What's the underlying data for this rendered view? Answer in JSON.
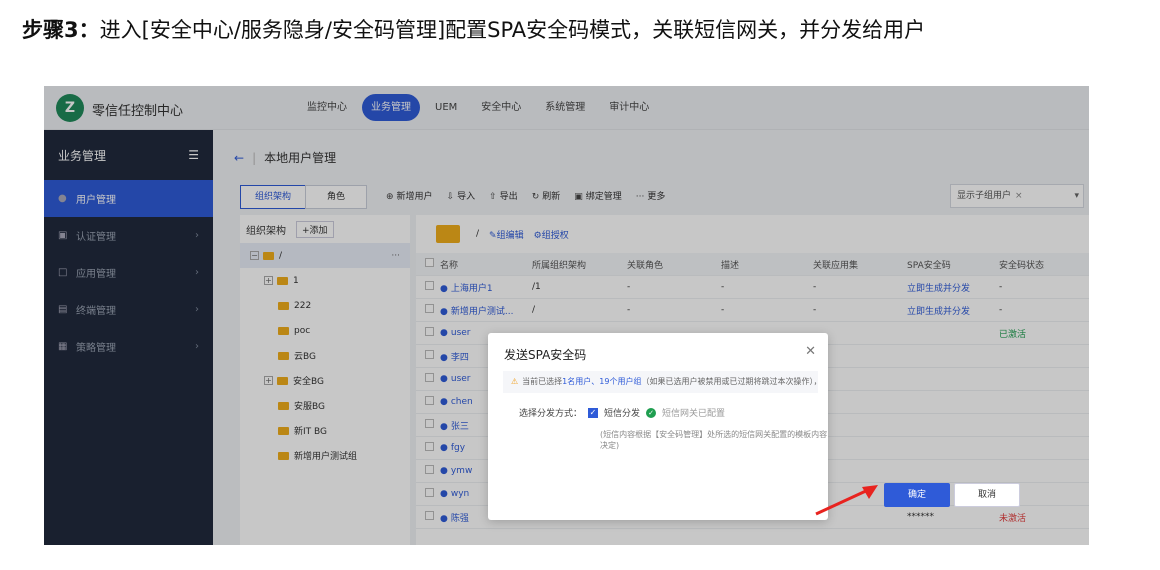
{
  "step": {
    "prefix": "步骤3：",
    "text": "进入[安全中心/服务隐身/安全码管理]配置SPA安全码模式，关联短信网关，并分发给用户"
  },
  "app": {
    "brand": "零信任控制中心",
    "nav": [
      "监控中心",
      "业务管理",
      "UEM",
      "安全中心",
      "系统管理",
      "审计中心"
    ],
    "nav_active": "业务管理"
  },
  "sidebar": {
    "header": "业务管理",
    "items": [
      {
        "label": "用户管理",
        "icon": "user-icon"
      },
      {
        "label": "认证管理",
        "icon": "certificate-icon"
      },
      {
        "label": "应用管理",
        "icon": "app-icon"
      },
      {
        "label": "终端管理",
        "icon": "terminal-icon"
      },
      {
        "label": "策略管理",
        "icon": "policy-icon"
      }
    ]
  },
  "page": {
    "title": "本地用户管理"
  },
  "tabs": [
    "组织架构",
    "角色"
  ],
  "toolbar": [
    "新增用户",
    "导入",
    "导出",
    "刷新",
    "绑定管理",
    "更多"
  ],
  "filter": {
    "tag": "显示子组用户"
  },
  "tree": {
    "title": "组织架构",
    "add_label": "+添加",
    "root": "/",
    "nodes": [
      "1",
      "222",
      "poc",
      "云BG",
      "安全BG",
      "安服BG",
      "新IT BG",
      "新增用户测试组"
    ]
  },
  "group": {
    "path": "/",
    "edit": "组编辑",
    "auth": "组授权"
  },
  "table": {
    "columns": [
      "名称",
      "所属组织架构",
      "关联角色",
      "描述",
      "关联应用集",
      "SPA安全码",
      "安全码状态"
    ],
    "rows": [
      {
        "name": "上海用户1",
        "org": "/1",
        "role": "-",
        "desc": "-",
        "apps": "-",
        "spa": "立即生成并分发",
        "status": "-"
      },
      {
        "name": "新增用户测试...",
        "org": "/",
        "role": "-",
        "desc": "-",
        "apps": "-",
        "spa": "立即生成并分发",
        "status": "-"
      },
      {
        "name": "user",
        "org": "",
        "role": "",
        "desc": "",
        "apps": "",
        "spa": "",
        "status": "已激活"
      },
      {
        "name": "李四",
        "org": "",
        "role": "",
        "desc": "",
        "apps": "",
        "spa": "",
        "status": ""
      },
      {
        "name": "user",
        "org": "",
        "role": "",
        "desc": "",
        "apps": "",
        "spa": "",
        "status": ""
      },
      {
        "name": "chen",
        "org": "",
        "role": "",
        "desc": "",
        "apps": "",
        "spa": "",
        "status": ""
      },
      {
        "name": "张三",
        "org": "",
        "role": "",
        "desc": "",
        "apps": "",
        "spa": "",
        "status": ""
      },
      {
        "name": "fgy",
        "org": "",
        "role": "",
        "desc": "",
        "apps": "",
        "spa": "",
        "status": ""
      },
      {
        "name": "ymw",
        "org": "",
        "role": "",
        "desc": "",
        "apps": "",
        "spa": "",
        "status": ""
      },
      {
        "name": "wyn",
        "org": "",
        "role": "",
        "desc": "",
        "apps": "",
        "spa": "",
        "status": ""
      },
      {
        "name": "陈强",
        "org": "/",
        "role": "-",
        "desc": "-",
        "apps": "-",
        "spa": "******",
        "status": "未激活"
      }
    ]
  },
  "modal": {
    "title": "发送SPA安全码",
    "tip_a": "当前已选择",
    "tip_b": "1名用户、19个用户组",
    "tip_c": "（如果已选用户被禁用或已过期将跳过本次操作），请选择用于发送短信的短信网关",
    "method_label": "选择分发方式：",
    "method_option": "短信分发",
    "gateway_status": "短信网关已配置",
    "note": "(短信内容根据【安全码管理】处所选的短信网关配置的模板内容决定)",
    "confirm": "确定",
    "cancel": "取消"
  },
  "colors": {
    "primary": "#2f5bd8",
    "sidebar": "#202a3d",
    "success": "#1f9e50",
    "danger": "#e23c3c",
    "annotation": "#e8231f"
  }
}
